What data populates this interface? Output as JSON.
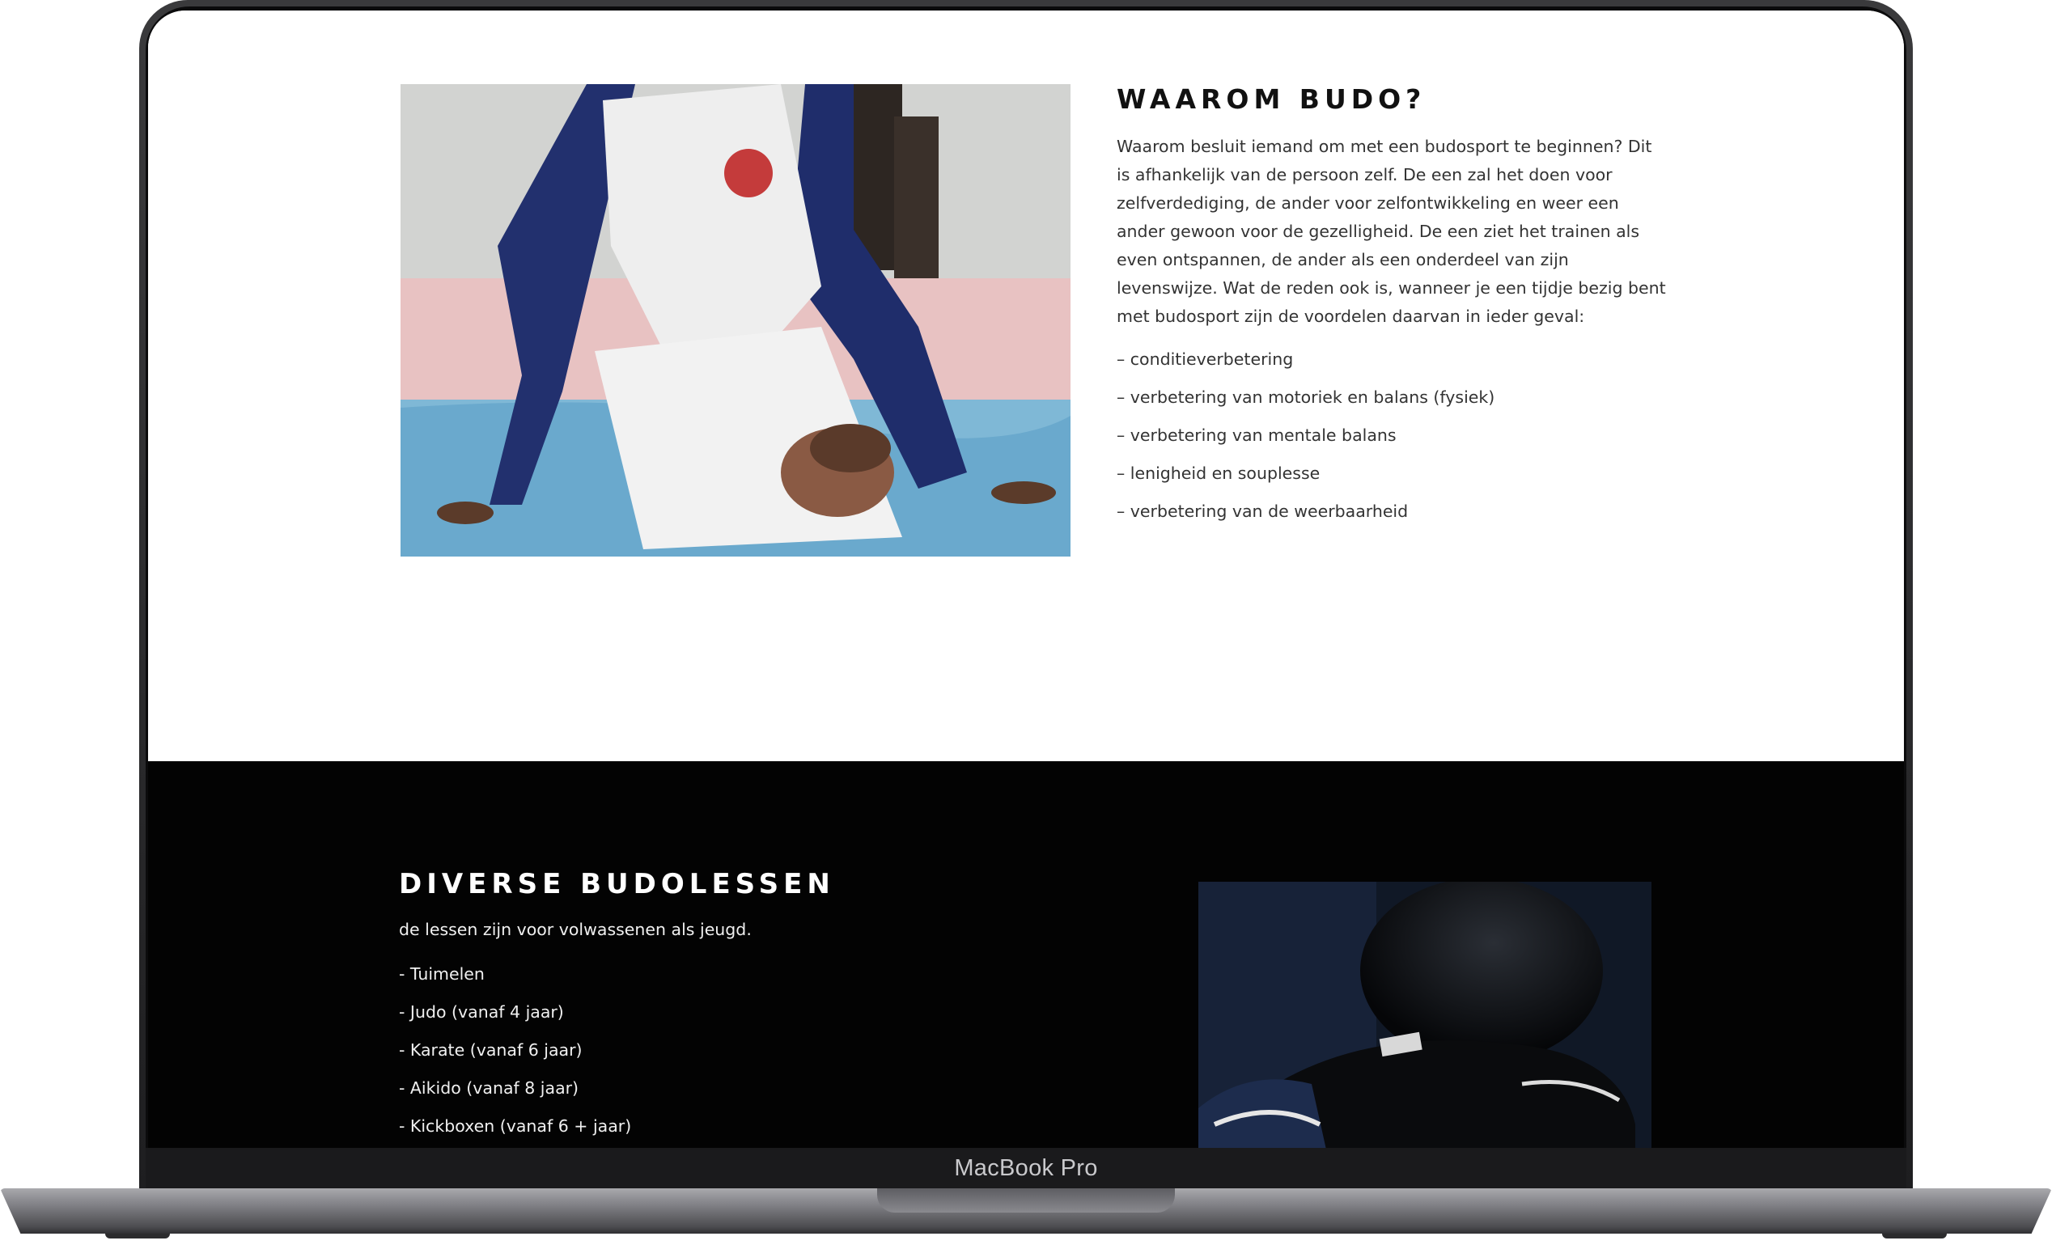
{
  "device": {
    "label": "MacBook Pro"
  },
  "why_section": {
    "title": "WAAROM BUDO?",
    "paragraph": "Waarom besluit iemand om met een budosport te beginnen? Dit is afhankelijk van de persoon zelf. De een zal het doen voor zelfverdediging, de ander voor zelfontwikkeling en weer een ander gewoon voor de gezelligheid. De een ziet het trainen als even ontspannen, de ander als een onderdeel van zijn levenswijze. Wat de reden ook is, wanneer je een tijdje bezig bent met budosport zijn de voordelen daarvan in ieder geval:",
    "benefits": [
      "– conditieverbetering",
      "– verbetering van motoriek en balans (fysiek)",
      "– verbetering van mentale balans",
      "– lenigheid en souplesse",
      "– verbetering van de weerbaarheid"
    ],
    "image_icon": "martial-arts-photo"
  },
  "lessons_section": {
    "title": "DIVERSE BUDOLESSEN",
    "intro": "de lessen zijn voor volwassenen als jeugd.",
    "lessons": [
      "- Tuimelen",
      "- Judo (vanaf 4 jaar)",
      "- Karate (vanaf 6 jaar)",
      "- Aikido (vanaf 8 jaar)",
      "- Kickboxen (vanaf 6 + jaar)"
    ],
    "image_icon": "boxing-glove-photo"
  },
  "colors": {
    "light_bg": "#ffffff",
    "dark_bg": "#030303",
    "heading_dark": "#111111",
    "body_text": "#333333"
  }
}
